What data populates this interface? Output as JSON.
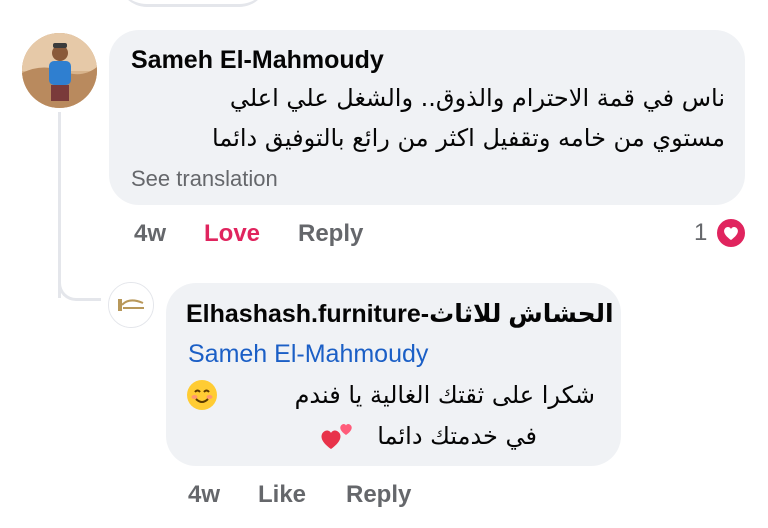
{
  "comment": {
    "author": "Sameh El-Mahmoudy",
    "lines": [
      "ناس في قمة الاحترام والذوق.. والشغل علي اعلي",
      "مستوي من خامه وتقفيل اكثر من رائع بالتوفيق دائما"
    ],
    "see_translation": "See translation",
    "time": "4w",
    "reaction_label": "Love",
    "reply_label": "Reply",
    "reaction_count": "1",
    "reaction_icon": "love-reaction-icon",
    "reaction_color": "#e0245e"
  },
  "reply": {
    "author": "Elhashash.furniture-الحشاش للاثاث",
    "mention": "Sameh El-Mahmoudy",
    "lines": [
      "شكرا على ثقتك الغالية يا فندم",
      "في خدمتك دائما"
    ],
    "emojis": [
      "smiling-face-icon",
      "two-hearts-icon"
    ],
    "time": "4w",
    "like_label": "Like",
    "reply_label": "Reply"
  },
  "colors": {
    "bubble_bg": "#f0f2f5",
    "secondary_text": "#65676b",
    "mention": "#1b5fc6",
    "love": "#e0245e"
  }
}
